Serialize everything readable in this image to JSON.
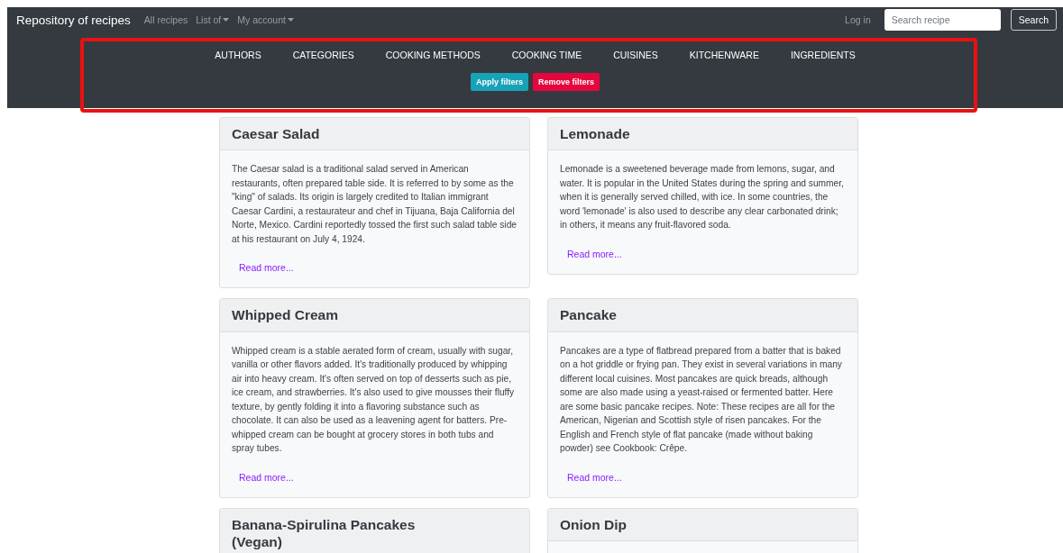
{
  "navbar": {
    "brand": "Repository of recipes",
    "links": [
      {
        "label": "All recipes",
        "dropdown": false
      },
      {
        "label": "List of",
        "dropdown": true
      },
      {
        "label": "My account",
        "dropdown": true
      }
    ],
    "login": "Log in",
    "search": {
      "placeholder": "Search recipe",
      "button": "Search"
    }
  },
  "filters": {
    "categories": [
      "AUTHORS",
      "CATEGORIES",
      "COOKING METHODS",
      "COOKING TIME",
      "CUISINES",
      "KITCHENWARE",
      "INGREDIENTS"
    ],
    "buttons": [
      {
        "label": "Apply filters",
        "kind": "apply"
      },
      {
        "label": "Remove filters",
        "kind": "remove"
      }
    ]
  },
  "recipes": [
    {
      "title": "Caesar Salad",
      "description": "The Caesar salad is a traditional salad served in American restaurants, often prepared table side. It is referred to by some as the \"king\" of salads. Its origin is largely credited to Italian immigrant Caesar Cardini, a restaurateur and chef in Tijuana, Baja California del Norte, Mexico. Cardini reportedly tossed the first such salad table side at his restaurant on July 4, 1924.",
      "link": "Read more..."
    },
    {
      "title": "Lemonade",
      "description": "Lemonade is a sweetened beverage made from lemons, sugar, and water. It is popular in the United States during the spring and summer, when it is generally served chilled, with ice. In some countries, the word 'lemonade' is also used to describe any clear carbonated drink; in others, it means any fruit-flavored soda.",
      "link": "Read more..."
    },
    {
      "title": "Whipped Cream",
      "description": "Whipped cream is a stable aerated form of cream, usually with sugar, vanilla or other flavors added. It's traditionally produced by whipping air into heavy cream. It's often served on top of desserts such as pie, ice cream, and strawberries. It's also used to give mousses their fluffy texture, by gently folding it into a flavoring substance such as chocolate. It can also be used as a leavening agent for batters. Pre-whipped cream can be bought at grocery stores in both tubs and spray tubes.",
      "link": "Read more..."
    },
    {
      "title": "Pancake",
      "description": "Pancakes are a type of flatbread prepared from a batter that is baked on a hot griddle or frying pan. They exist in several variations in many different local cuisines. Most pancakes are quick breads, although some are also made using a yeast-raised or fermented batter. Here are some basic pancake recipes. Note: These recipes are all for the American, Nigerian and Scottish style of risen pancakes. For the English and French style of flat pancake (made without baking powder) see Cookbook: Crêpe.",
      "link": "Read more..."
    },
    {
      "title": "Banana-Spirulina Pancakes (Vegan)"
    },
    {
      "title": "Onion Dip"
    }
  ]
}
